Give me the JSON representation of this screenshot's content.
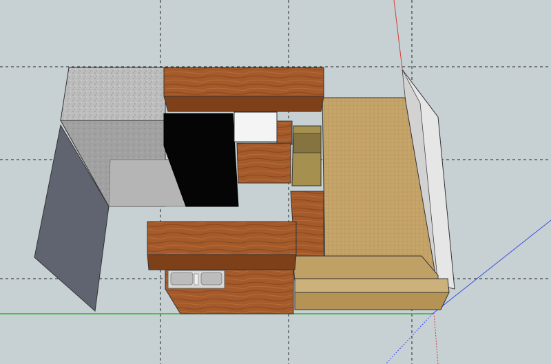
{
  "viewport": {
    "background": "#c7d0d3"
  },
  "axes": {
    "red_axis_color": "#d43a3a",
    "green_axis_color": "#2fb42f",
    "blue_axis_color": "#3a4fe0",
    "guide_color": "#222222"
  },
  "materials": {
    "wood": "#a45a2a",
    "wood_dark": "#7e4019",
    "granite": "#9c9c9c",
    "granite_top": "#bdbdbd",
    "slate": "#5f6470",
    "black_panel": "#050505",
    "white_block": "#f4f4f4",
    "fabric": "#c6a56a",
    "fabric_dark": "#9d8652",
    "wall_white": "#e8e8e8",
    "sink": "#d8d8d8"
  },
  "model_parts": [
    "granite-block",
    "slate-side-panel",
    "upper-cabinet",
    "black-appliance",
    "white-block",
    "middle-cabinet",
    "couch-seat",
    "couch-back",
    "right-wall",
    "front-counter",
    "sink-cabinet",
    "kitchen-sink"
  ]
}
